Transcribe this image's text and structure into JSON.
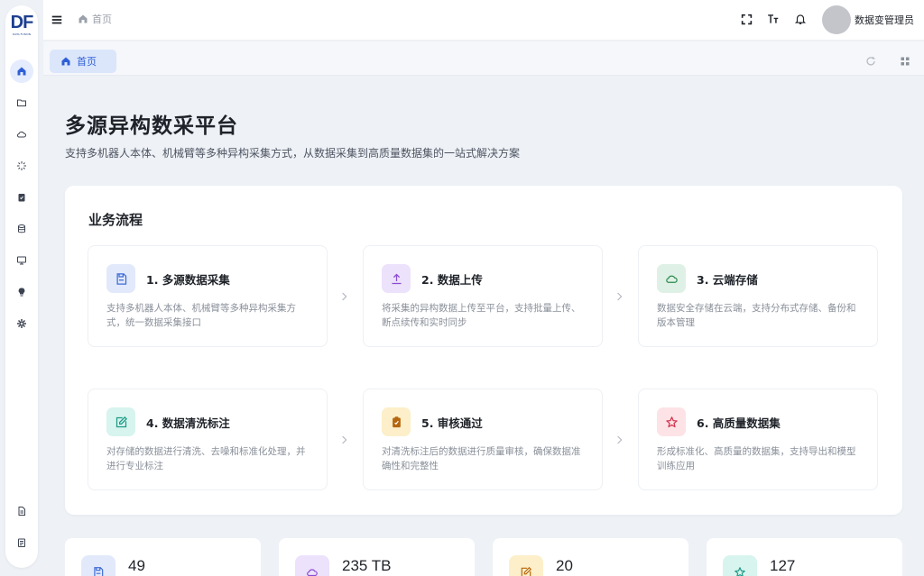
{
  "logo": {
    "mark": "DF",
    "sub": "DATA FUSION"
  },
  "header": {
    "breadcrumb": "首页",
    "username": "数据变管理员"
  },
  "tabs": [
    {
      "label": "首页"
    }
  ],
  "page": {
    "title": "多源异构数采平台",
    "subtitle": "支持多机器人本体、机械臂等多种异构采集方式，从数据采集到高质量数据集的一站式解决方案"
  },
  "workflow": {
    "title": "业务流程",
    "steps": [
      {
        "title": "1. 多源数据采集",
        "desc": "支持多机器人本体、机械臂等多种异构采集方式，统一数据采集接口",
        "icon": "save-icon",
        "color": "#3d6bd6",
        "bg": "#e2e9fb"
      },
      {
        "title": "2. 数据上传",
        "desc": "将采集的异构数据上传至平台，支持批量上传、断点续传和实时同步",
        "icon": "upload-icon",
        "color": "#8a4bd1",
        "bg": "#ece2fb"
      },
      {
        "title": "3. 云端存储",
        "desc": "数据安全存储在云端，支持分布式存储、备份和版本管理",
        "icon": "cloud-icon",
        "color": "#2d8a4e",
        "bg": "#dff1e6"
      },
      {
        "title": "4. 数据清洗标注",
        "desc": "对存储的数据进行清洗、去噪和标准化处理，并进行专业标注",
        "icon": "edit-icon",
        "color": "#1d9a86",
        "bg": "#d7f4ee"
      },
      {
        "title": "5. 审核通过",
        "desc": "对清洗标注后的数据进行质量审核，确保数据准确性和完整性",
        "icon": "clipboard-check-icon",
        "color": "#b5670f",
        "bg": "#fcefc9"
      },
      {
        "title": "6. 高质量数据集",
        "desc": "形成标准化、高质量的数据集，支持导出和模型训练应用",
        "icon": "star-icon",
        "color": "#d1344c",
        "bg": "#fde3e6"
      }
    ]
  },
  "stats": [
    {
      "value": "49",
      "icon": "save-icon",
      "color": "#3d6bd6",
      "bg": "#e2e9fb"
    },
    {
      "value": "235 TB",
      "icon": "cloud-icon",
      "color": "#8a4bd1",
      "bg": "#ece2fb"
    },
    {
      "value": "20",
      "icon": "edit-icon",
      "color": "#b5670f",
      "bg": "#fcefc9"
    },
    {
      "value": "127",
      "icon": "star-icon",
      "color": "#1d9a86",
      "bg": "#d7f4ee"
    }
  ]
}
